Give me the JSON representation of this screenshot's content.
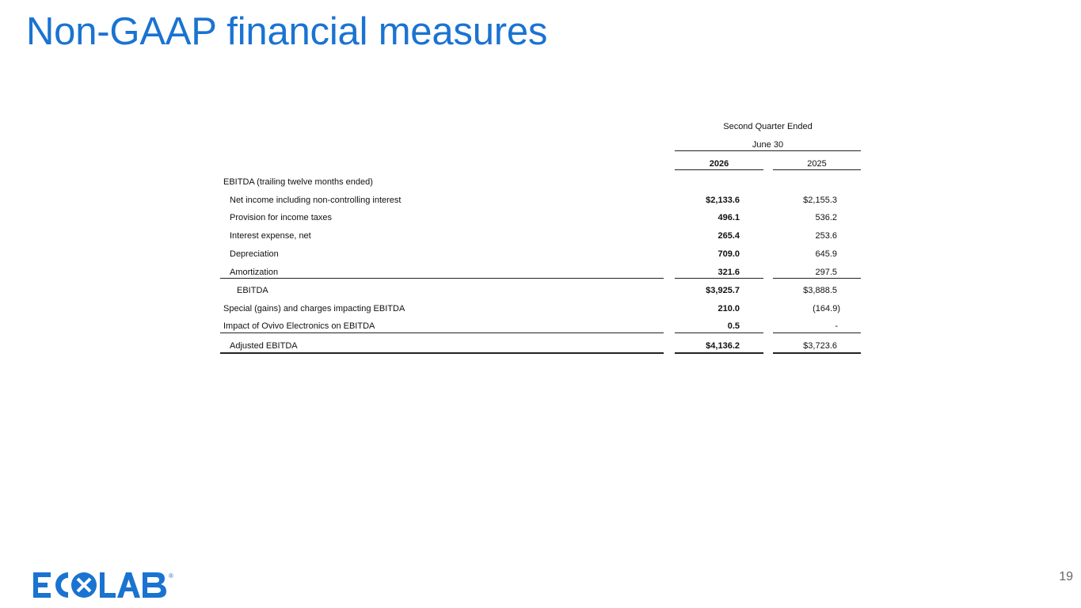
{
  "title": "Non-GAAP financial measures",
  "header": {
    "period": "Second Quarter Ended",
    "date": "June 30",
    "col_current": "2026",
    "col_prior": "2025"
  },
  "section_label": "EBITDA (trailing twelve months ended)",
  "rows": [
    {
      "label": "Net income including non-controlling interest",
      "v2026": "$2,133.6",
      "v2025": "$2,155.3"
    },
    {
      "label": "Provision for income taxes",
      "v2026": "496.1",
      "v2025": "536.2"
    },
    {
      "label": "Interest expense, net",
      "v2026": "265.4",
      "v2025": "253.6"
    },
    {
      "label": "Depreciation",
      "v2026": "709.0",
      "v2025": "645.9"
    },
    {
      "label": "Amortization",
      "v2026": "321.6",
      "v2025": "297.5"
    },
    {
      "label": "EBITDA",
      "v2026": "$3,925.7",
      "v2025": "$3,888.5"
    },
    {
      "label": "Special (gains) and charges impacting EBITDA",
      "v2026": "210.0",
      "v2025": "(164.9)"
    },
    {
      "label": "Impact of Ovivo Electronics on EBITDA",
      "v2026": "0.5",
      "v2025": "-"
    },
    {
      "label": "Adjusted EBITDA",
      "v2026": "$4,136.2",
      "v2025": "$3,723.6"
    }
  ],
  "logo": {
    "text": "ECOLAB",
    "registered": "®",
    "color": "#1a73d1"
  },
  "page_number": "19"
}
